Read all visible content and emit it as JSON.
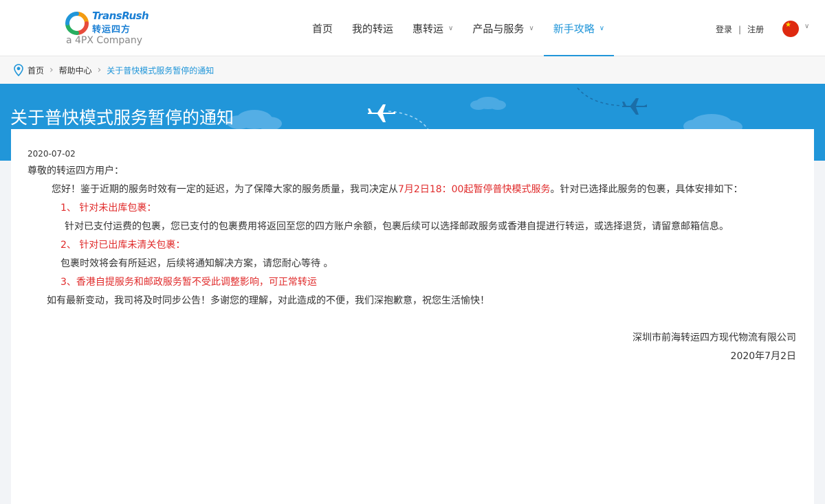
{
  "header": {
    "logo": {
      "brand_en": "TransRush",
      "brand_cn": "转运四方",
      "tagline": "a 4PX Company"
    },
    "nav": [
      {
        "label": "首页",
        "has_dropdown": false,
        "active": false
      },
      {
        "label": "我的转运",
        "has_dropdown": false,
        "active": false
      },
      {
        "label": "惠转运",
        "has_dropdown": true,
        "active": false
      },
      {
        "label": "产品与服务",
        "has_dropdown": true,
        "active": false
      },
      {
        "label": "新手攻略",
        "has_dropdown": true,
        "active": true
      }
    ],
    "auth": {
      "login": "登录",
      "separator": "|",
      "register": "注册"
    },
    "language_icon": "china-flag-icon"
  },
  "breadcrumb": [
    "首页",
    "帮助中心",
    "关于普快模式服务暂停的通知"
  ],
  "banner": {
    "title": "关于普快模式服务暂停的通知"
  },
  "notice": {
    "date": "2020-07-02",
    "greeting": "尊敬的转运四方用户：",
    "intro_before": "您好！鉴于近期的服务时效有一定的延迟，为了保障大家的服务质量，我司决定从",
    "intro_highlight": "7月2日18：00起暂停普快模式服务",
    "intro_after": "。针对已选择此服务的包裹，具体安排如下：",
    "item1_title": "1、 针对未出库包裹：",
    "item1_body": "针对已支付运费的包裹，您已支付的包裹费用将返回至您的四方账户余额，包裹后续可以选择邮政服务或香港自提进行转运，或选择退货，请留意邮箱信息。",
    "item2_title": "2、 针对已出库未清关包裹：",
    "item2_body": "包裹时效将会有所延迟，后续将通知解决方案，请您耐心等待 。",
    "item3": "3、香港自提服务和邮政服务暂不受此调整影响，可正常转运",
    "closing": "如有最新变动，我司将及时同步公告！多谢您的理解，对此造成的不便，我们深抱歉意，祝您生活愉快！",
    "company": "深圳市前海转运四方现代物流有限公司",
    "sign_date": "2020年7月2日"
  },
  "colors": {
    "primary": "#2196d9",
    "highlight": "#e02b2b"
  }
}
